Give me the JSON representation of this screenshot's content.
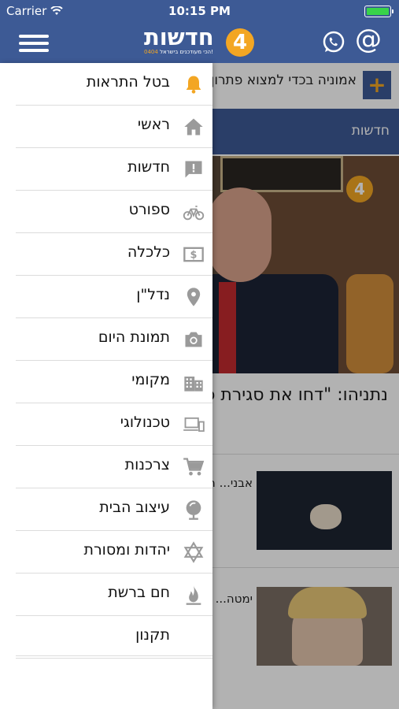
{
  "status_bar": {
    "carrier": "Carrier",
    "time": "10:15 PM"
  },
  "header": {
    "logo_text": "חדשות",
    "logo_number": "4",
    "logo_tagline": "הכי מעודכנים בישראל!",
    "logo_tagline_code": "0404",
    "menu_icon": "hamburger-icon",
    "whatsapp_icon": "whatsapp-icon",
    "email_icon": "at-icon"
  },
  "ticker": {
    "text": "אמוניה בכדי למצוא פתרון",
    "plus": "+"
  },
  "section": {
    "title": "חדשות"
  },
  "hero": {
    "title": "נתניהו: \"דחו את סגירת פתרון לפיטורי אלפים\""
  },
  "articles": [
    {
      "text": "אבני... חוסא..."
    },
    {
      "text": "ימטה... קריא... בסיב..."
    }
  ],
  "menu": {
    "items": [
      {
        "label": "בטל התראות",
        "icon": "bell-icon",
        "color": "#f3a623"
      },
      {
        "label": "ראשי",
        "icon": "home-icon",
        "color": "#9a9a9a"
      },
      {
        "label": "חדשות",
        "icon": "alert-message-icon",
        "color": "#9a9a9a"
      },
      {
        "label": "ספורט",
        "icon": "bicycle-icon",
        "color": "#9a9a9a"
      },
      {
        "label": "כלכלה",
        "icon": "dollar-bill-icon",
        "color": "#9a9a9a"
      },
      {
        "label": "נדל\"ן",
        "icon": "location-pin-icon",
        "color": "#9a9a9a"
      },
      {
        "label": "תמונת היום",
        "icon": "camera-icon",
        "color": "#9a9a9a"
      },
      {
        "label": "מקומי",
        "icon": "city-icon",
        "color": "#9a9a9a"
      },
      {
        "label": "טכנולוגי",
        "icon": "devices-icon",
        "color": "#9a9a9a"
      },
      {
        "label": "צרכנות",
        "icon": "shopping-cart-icon",
        "color": "#9a9a9a"
      },
      {
        "label": "עיצוב הבית",
        "icon": "lamp-icon",
        "color": "#9a9a9a"
      },
      {
        "label": "יהדות ומסורת",
        "icon": "star-of-david-icon",
        "color": "#9a9a9a"
      },
      {
        "label": "חם ברשת",
        "icon": "flame-icon",
        "color": "#9a9a9a"
      },
      {
        "label": "תקנון",
        "icon": "",
        "color": "#9a9a9a"
      }
    ]
  }
}
